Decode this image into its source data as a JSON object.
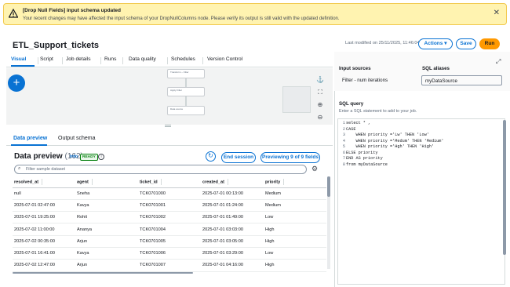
{
  "banner": {
    "title": "[Drop Null Fields] input schema updated",
    "message": "Your recent changes may have affected the input schema of your DropNullColumns node. Please verify its output is still valid with the updated definition."
  },
  "header": {
    "job_title": "ETL_Support_tickets",
    "last_modified": "Last modified on 25/11/2025, 11:46:04",
    "actions_label": "Actions ▾",
    "save_label": "Save",
    "run_label": "Run"
  },
  "tabs": [
    "Visual",
    "Script",
    "Job details",
    "Runs",
    "Data quality",
    "Schedules",
    "Version Control"
  ],
  "canvas": {
    "nodes": [
      "Transform – Filter",
      "Apply Filter",
      "Data source"
    ]
  },
  "bottom_tabs": [
    "Data preview",
    "Output schema"
  ],
  "preview": {
    "title": "Data preview",
    "count": "(162)",
    "info": "Info",
    "status": "READY",
    "end_session": "End session",
    "previewing": "Previewing 9 of 9 fields",
    "filter_placeholder": "Filter sample dataset",
    "columns": [
      "resolved_at",
      "agent",
      "ticket_id",
      "created_at",
      "priority"
    ],
    "rows": [
      [
        "null",
        "Sneha",
        "TCK0701000",
        "2025-07-01 00:13:00",
        "Medium"
      ],
      [
        "2025-07-01 02:47:00",
        "Kavya",
        "TCK0701001",
        "2025-07-01 01:24:00",
        "Medium"
      ],
      [
        "2025-07-01 19:25:00",
        "Rohit",
        "TCK0701002",
        "2025-07-01 01:49:00",
        "Low"
      ],
      [
        "2025-07-02 11:00:00",
        "Ananya",
        "TCK0701004",
        "2025-07-01 03:03:00",
        "High"
      ],
      [
        "2025-07-02 00:35:00",
        "Arjun",
        "TCK0701005",
        "2025-07-01 03:05:00",
        "High"
      ],
      [
        "2025-07-01 16:41:00",
        "Kavya",
        "TCK0701006",
        "2025-07-01 03:29:00",
        "Low"
      ],
      [
        "2025-07-02 12:47:00",
        "Arjun",
        "TCK0701007",
        "2025-07-01 04:16:00",
        "High"
      ]
    ]
  },
  "right_panel": {
    "input_sources_label": "Input sources",
    "sql_aliases_label": "SQL aliases",
    "input_source": "Filter - num iterations",
    "alias_value": "myDataSource",
    "sql_query_label": "SQL query",
    "sql_help": "Enter a SQL statement to add to your job.",
    "code_lines": [
      "select * ,",
      "CASE",
      "    WHEN priority ='Lw' THEN 'Low'",
      "    WHEN priority ='Medum' THEN 'Medium'",
      "    WHEN priority ='Hgh' THEN 'High'",
      "ELSE priority",
      "END AS priority",
      "from myDataSource"
    ],
    "line_numbers": [
      "1",
      "2",
      "3",
      "4",
      "5",
      "6",
      "7",
      "8"
    ]
  }
}
